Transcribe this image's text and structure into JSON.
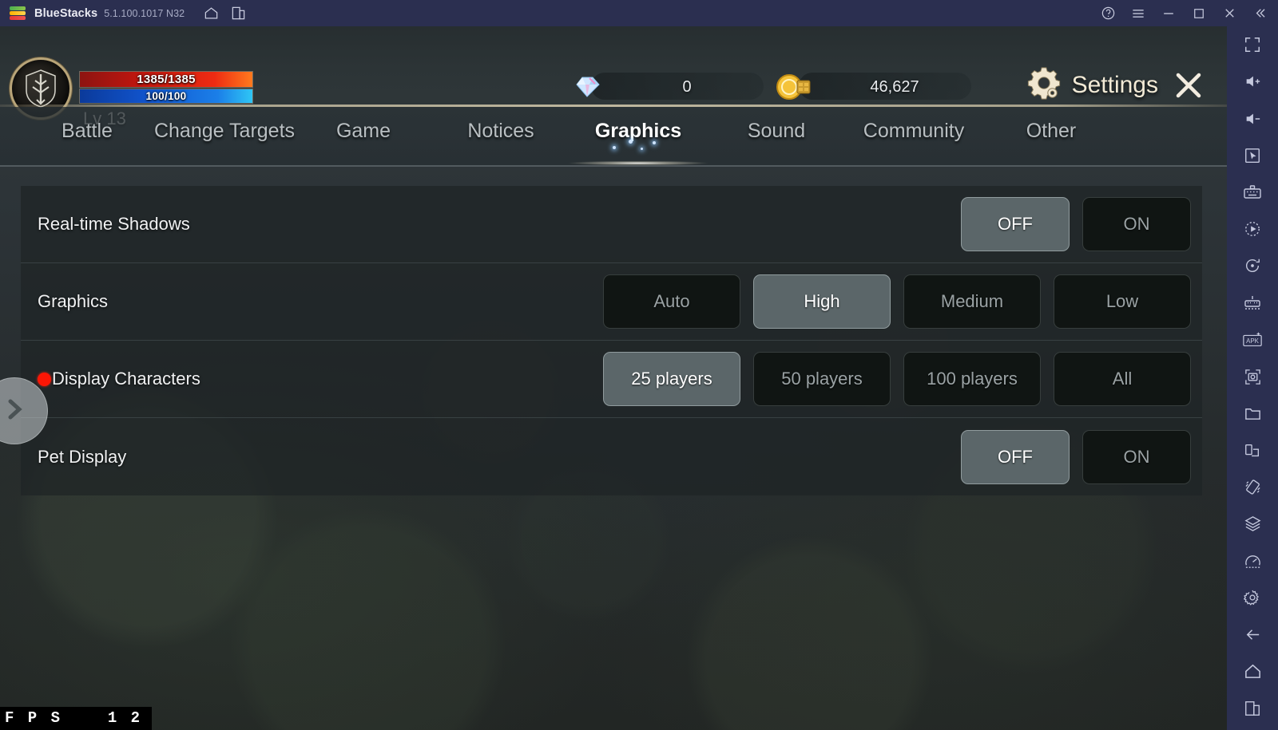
{
  "titlebar": {
    "app_name": "BlueStacks",
    "version": "5.1.100.1017 N32",
    "left_icons": [
      {
        "name": "home-icon"
      },
      {
        "name": "multi-instance-icon"
      }
    ],
    "right_icons": [
      {
        "name": "help-icon"
      },
      {
        "name": "menu-icon"
      },
      {
        "name": "minimize-icon"
      },
      {
        "name": "maximize-icon"
      },
      {
        "name": "close-icon"
      },
      {
        "name": "collapse-sidebar-icon"
      }
    ]
  },
  "hud": {
    "avatar_icon": "shield-sword-emblem-icon",
    "hp": "1385/1385",
    "mp": "100/100",
    "level": "Lv 13",
    "gem_icon": "diamond-icon",
    "gem_value": "0",
    "gold_icon": "gold-coin-icon",
    "gold_value": "46,627",
    "settings_label": "Settings",
    "settings_icon": "gear-icon",
    "close_icon": "close-x-icon"
  },
  "tabs": [
    {
      "label": "Battle",
      "active": false
    },
    {
      "label": "Change Targets",
      "active": false
    },
    {
      "label": "Game",
      "active": false
    },
    {
      "label": "Notices",
      "active": false
    },
    {
      "label": "Graphics",
      "active": true
    },
    {
      "label": "Sound",
      "active": false
    },
    {
      "label": "Community",
      "active": false
    },
    {
      "label": "Other",
      "active": false
    }
  ],
  "settings_rows": [
    {
      "label": "Real-time Shadows",
      "marker": false,
      "options": [
        {
          "label": "OFF",
          "selected": true
        },
        {
          "label": "ON",
          "selected": false
        }
      ]
    },
    {
      "label": "Graphics",
      "marker": false,
      "options": [
        {
          "label": "Auto",
          "selected": false
        },
        {
          "label": "High",
          "selected": true
        },
        {
          "label": "Medium",
          "selected": false
        },
        {
          "label": "Low",
          "selected": false
        }
      ]
    },
    {
      "label": "Display Characters",
      "marker": true,
      "options": [
        {
          "label": "25 players",
          "selected": true
        },
        {
          "label": "50 players",
          "selected": false
        },
        {
          "label": "100 players",
          "selected": false
        },
        {
          "label": "All",
          "selected": false
        }
      ]
    },
    {
      "label": "Pet Display",
      "marker": false,
      "options": [
        {
          "label": "OFF",
          "selected": true
        },
        {
          "label": "ON",
          "selected": false
        }
      ]
    }
  ],
  "overlay": {
    "float_button_icon": "chevron-right-icon",
    "fps_label": "F P S",
    "fps_value": "1 2"
  },
  "sidebar_icons": [
    {
      "name": "fullscreen-icon"
    },
    {
      "name": "volume-up-icon"
    },
    {
      "name": "volume-down-icon"
    },
    {
      "name": "cursor-pointer-icon"
    },
    {
      "name": "keyboard-controls-icon"
    },
    {
      "name": "macro-recorder-icon"
    },
    {
      "name": "rotate-screen-icon"
    },
    {
      "name": "gamepad-controls-icon"
    },
    {
      "name": "install-apk-icon"
    },
    {
      "name": "screenshot-icon"
    },
    {
      "name": "media-folder-icon"
    },
    {
      "name": "multi-instance-manager-icon"
    },
    {
      "name": "shake-icon"
    },
    {
      "name": "layers-eco-mode-icon"
    },
    {
      "name": "performance-meter-icon"
    },
    {
      "name": "settings-gear-icon"
    },
    {
      "name": "back-arrow-icon"
    },
    {
      "name": "home-nav-icon"
    },
    {
      "name": "recent-apps-icon"
    }
  ],
  "colors": {
    "titlebar_bg": "#2b2f50",
    "sidebar_bg": "#2b2f50",
    "hp_bar": "#ee2b12",
    "mp_bar": "#1b7fe8",
    "selected_option_bg": "#5b6669",
    "unselected_option_bg": "#101513",
    "marker_dot": "#fb1605",
    "settings_text": "#f2ead6"
  }
}
